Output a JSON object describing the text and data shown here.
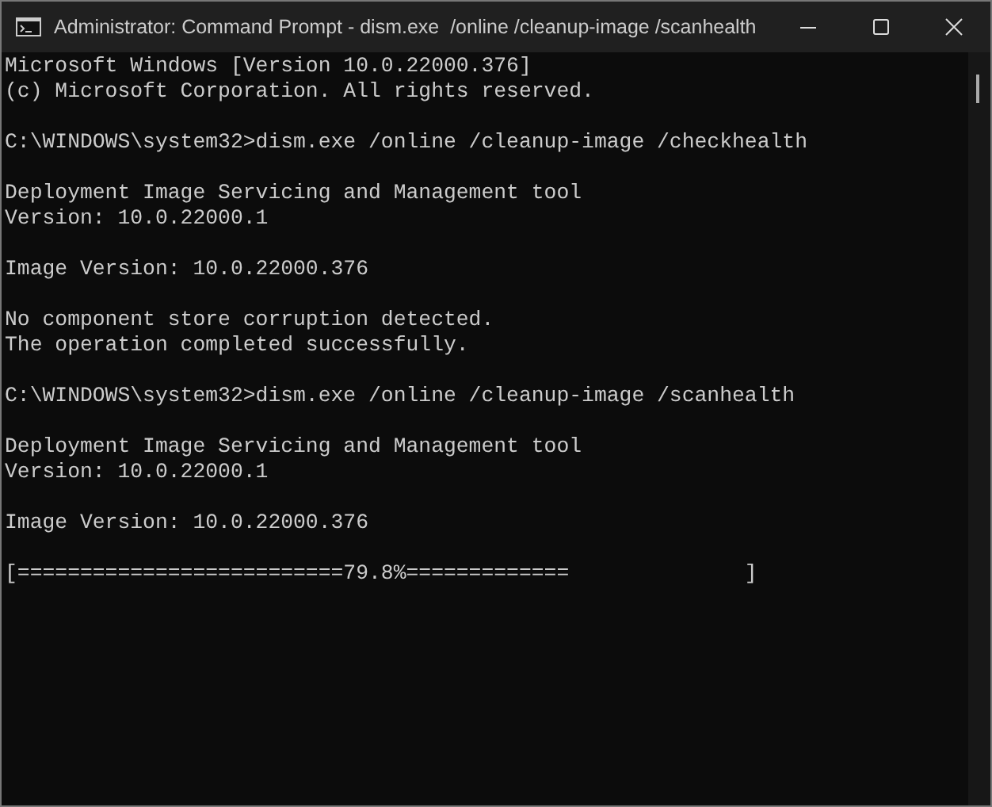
{
  "window": {
    "title": "Administrator: Command Prompt - dism.exe  /online /cleanup-image /scanhealth"
  },
  "console": {
    "blocks": [
      [
        "Microsoft Windows [Version 10.0.22000.376]",
        "(c) Microsoft Corporation. All rights reserved."
      ],
      [
        "C:\\WINDOWS\\system32>dism.exe /online /cleanup-image /checkhealth"
      ],
      [
        "Deployment Image Servicing and Management tool",
        "Version: 10.0.22000.1"
      ],
      [
        "Image Version: 10.0.22000.376"
      ],
      [
        "No component store corruption detected.",
        "The operation completed successfully."
      ],
      [
        "C:\\WINDOWS\\system32>dism.exe /online /cleanup-image /scanhealth"
      ],
      [
        "Deployment Image Servicing and Management tool",
        "Version: 10.0.22000.1"
      ],
      [
        "Image Version: 10.0.22000.376"
      ],
      [
        "[==========================79.8%=============              ]"
      ]
    ]
  }
}
